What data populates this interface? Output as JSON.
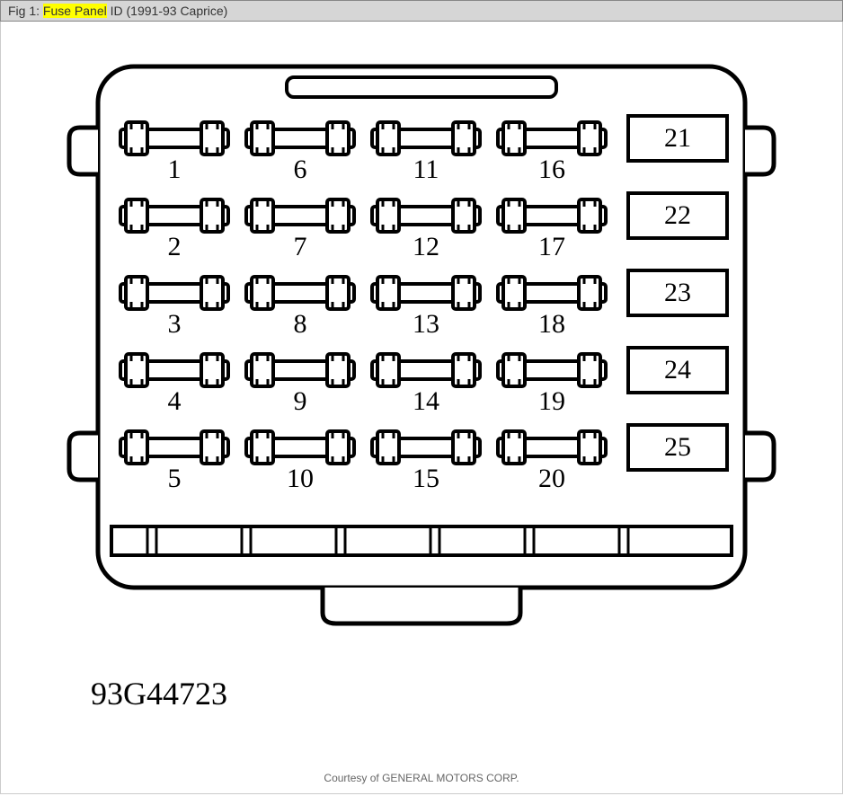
{
  "header": {
    "prefix": "Fig 1: ",
    "highlight": "Fuse Panel",
    "suffix": " ID (1991-93 Caprice)"
  },
  "fuses": {
    "col1": [
      "1",
      "2",
      "3",
      "4",
      "5"
    ],
    "col2": [
      "6",
      "7",
      "8",
      "9",
      "10"
    ],
    "col3": [
      "11",
      "12",
      "13",
      "14",
      "15"
    ],
    "col4": [
      "16",
      "17",
      "18",
      "19",
      "20"
    ]
  },
  "relays": [
    "21",
    "22",
    "23",
    "24",
    "25"
  ],
  "reference": "93G44723",
  "credit": "Courtesy of GENERAL MOTORS CORP."
}
